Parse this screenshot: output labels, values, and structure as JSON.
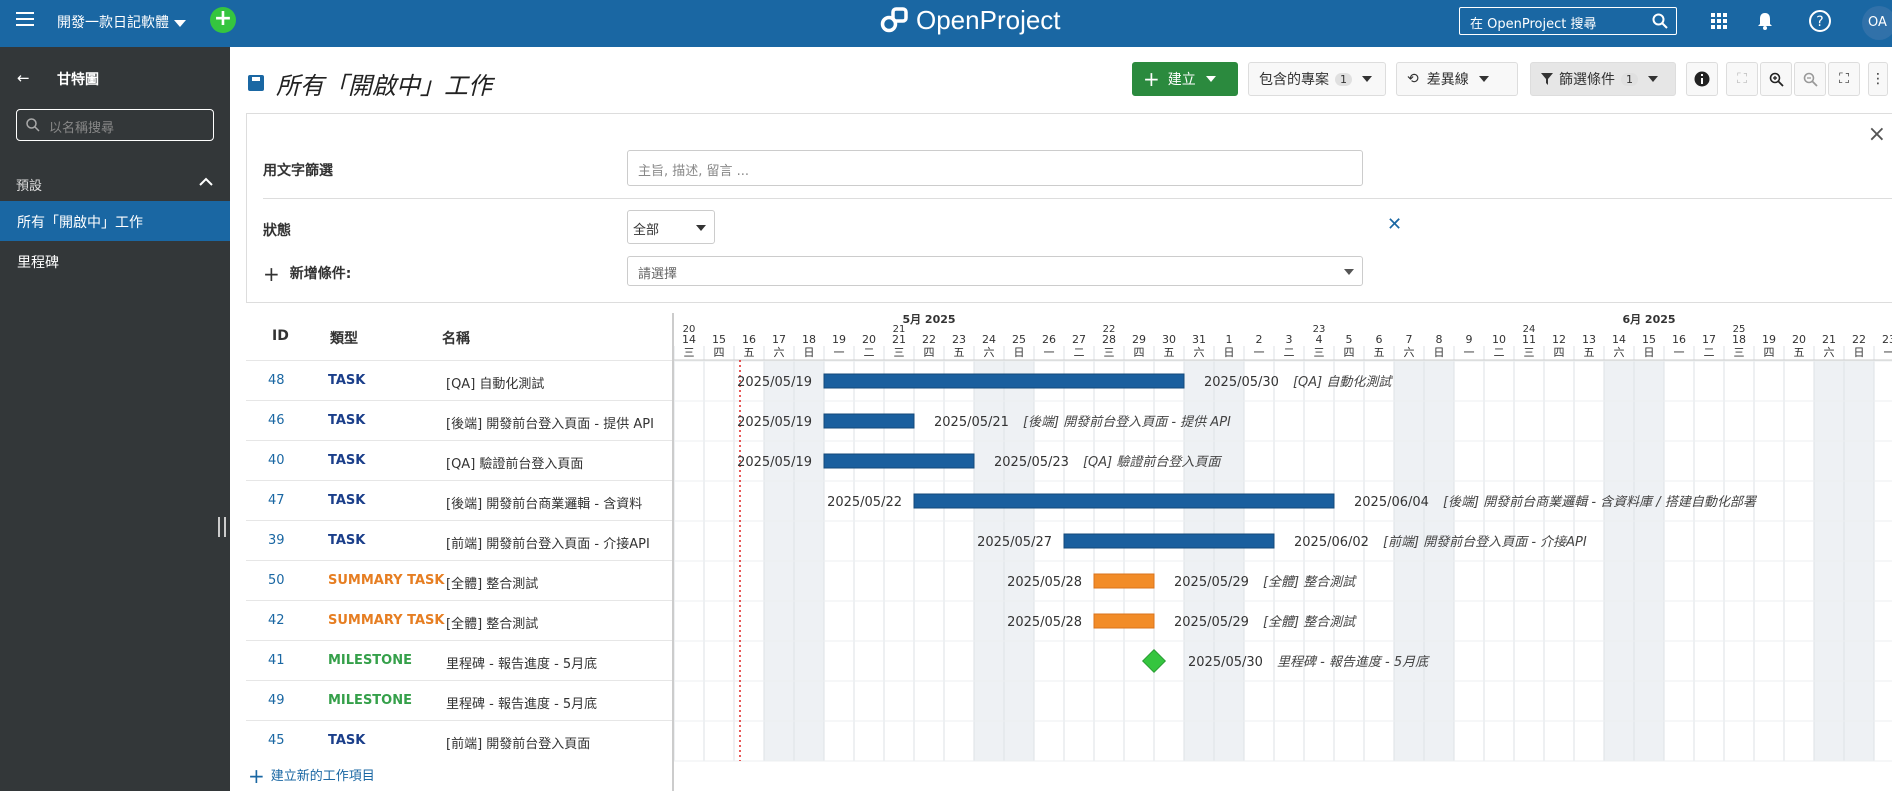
{
  "header": {
    "project": "開發一款日記軟體",
    "logo": "OpenProject",
    "search_placeholder": "在 OpenProject 搜尋",
    "avatar": "OA"
  },
  "sidebar": {
    "title": "甘特圖",
    "search_placeholder": "以名稱搜尋",
    "section": "預設",
    "items": [
      {
        "label": "所有「開啟中」工作"
      },
      {
        "label": "里程碑"
      }
    ]
  },
  "toolbar": {
    "page_title": "所有「開啟中」工作",
    "create": "建立",
    "include_projects": "包含的專案",
    "include_projects_count": "1",
    "baseline": "差異線",
    "filter": "篩選條件",
    "filter_count": "1"
  },
  "filters": {
    "text_label": "用文字篩選",
    "text_placeholder": "主旨, 描述, 留言 ...",
    "status_label": "狀態",
    "status_value": "全部",
    "add_label": "新增條件:",
    "add_placeholder": "請選擇"
  },
  "table": {
    "headers": {
      "id": "ID",
      "type": "類型",
      "name": "名稱"
    },
    "add_row": "建立新的工作項目",
    "rows": [
      {
        "id": "48",
        "type": "TASK",
        "name": "[QA] 自動化測試"
      },
      {
        "id": "46",
        "type": "TASK",
        "name": "[後端] 開發前台登入頁面 - 提供 API"
      },
      {
        "id": "40",
        "type": "TASK",
        "name": "[QA] 驗證前台登入頁面"
      },
      {
        "id": "47",
        "type": "TASK",
        "name": "[後端] 開發前台商業邏輯 - 含資料"
      },
      {
        "id": "39",
        "type": "TASK",
        "name": "[前端] 開發前台登入頁面 - 介接API"
      },
      {
        "id": "50",
        "type": "SUMMARY TASK",
        "name": "[全體] 整合測試"
      },
      {
        "id": "42",
        "type": "SUMMARY TASK",
        "name": "[全體] 整合測試"
      },
      {
        "id": "41",
        "type": "MILESTONE",
        "name": "里程碑 - 報告進度 - 5月底"
      },
      {
        "id": "49",
        "type": "MILESTONE",
        "name": "里程碑 - 報告進度 - 5月底"
      },
      {
        "id": "45",
        "type": "TASK",
        "name": "[前端] 開發前台登入頁面"
      }
    ]
  },
  "gantt": {
    "months": [
      {
        "label": "5月 2025",
        "day_index": 8
      },
      {
        "label": "6月 2025",
        "day_index": 32
      }
    ],
    "week_numbers": [
      {
        "label": "20",
        "day_index": 0
      },
      {
        "label": "21",
        "day_index": 7
      },
      {
        "label": "22",
        "day_index": 14
      },
      {
        "label": "23",
        "day_index": 21
      },
      {
        "label": "24",
        "day_index": 28
      },
      {
        "label": "25",
        "day_index": 35
      }
    ],
    "days": [
      "14",
      "15",
      "16",
      "17",
      "18",
      "19",
      "20",
      "21",
      "22",
      "23",
      "24",
      "25",
      "26",
      "27",
      "28",
      "29",
      "30",
      "31",
      "1",
      "2",
      "3",
      "4",
      "5",
      "6",
      "7",
      "8",
      "9",
      "10",
      "11",
      "12",
      "13",
      "14",
      "15",
      "16",
      "17",
      "18",
      "19",
      "20",
      "21",
      "22",
      "23"
    ],
    "weekdays": [
      "三",
      "四",
      "五",
      "六",
      "日",
      "一",
      "二",
      "三",
      "四",
      "五",
      "六",
      "日",
      "一",
      "二",
      "三",
      "四",
      "五",
      "六",
      "日",
      "一",
      "二",
      "三",
      "四",
      "五",
      "六",
      "日",
      "一",
      "二",
      "三",
      "四",
      "五",
      "六",
      "日",
      "一",
      "二",
      "三",
      "四",
      "五",
      "六",
      "日",
      "一"
    ],
    "today_index": 2.2,
    "bars": [
      {
        "row": 0,
        "kind": "task",
        "start": 5,
        "end": 17,
        "start_label": "2025/05/19",
        "end_label": "2025/05/30",
        "caption": "[QA] 自動化測試"
      },
      {
        "row": 1,
        "kind": "task",
        "start": 5,
        "end": 8,
        "start_label": "2025/05/19",
        "end_label": "2025/05/21",
        "caption": "[後端] 開發前台登入頁面 - 提供 API"
      },
      {
        "row": 2,
        "kind": "task",
        "start": 5,
        "end": 10,
        "start_label": "2025/05/19",
        "end_label": "2025/05/23",
        "caption": "[QA] 驗證前台登入頁面"
      },
      {
        "row": 3,
        "kind": "task",
        "start": 8,
        "end": 22,
        "start_label": "2025/05/22",
        "end_label": "2025/06/04",
        "caption": "[後端] 開發前台商業邏輯 - 含資料庫 / 搭建自動化部署"
      },
      {
        "row": 4,
        "kind": "task",
        "start": 13,
        "end": 20,
        "start_label": "2025/05/27",
        "end_label": "2025/06/02",
        "caption": "[前端] 開發前台登入頁面 - 介接API"
      },
      {
        "row": 5,
        "kind": "summary",
        "start": 14,
        "end": 16,
        "start_label": "2025/05/28",
        "end_label": "2025/05/29",
        "caption": "[全體] 整合測試"
      },
      {
        "row": 6,
        "kind": "summary",
        "start": 14,
        "end": 16,
        "start_label": "2025/05/28",
        "end_label": "2025/05/29",
        "caption": "[全體] 整合測試"
      },
      {
        "row": 7,
        "kind": "milestone",
        "start": 16,
        "end": 16,
        "start_label": "",
        "end_label": "2025/05/30",
        "caption": "里程碑 - 報告進度 - 5月底"
      }
    ],
    "colors": {
      "task": "#1a5f9e",
      "summary": "#f28c28",
      "milestone": "#35c53f",
      "weekend": "#eef1f4",
      "today": "#e02020"
    }
  }
}
